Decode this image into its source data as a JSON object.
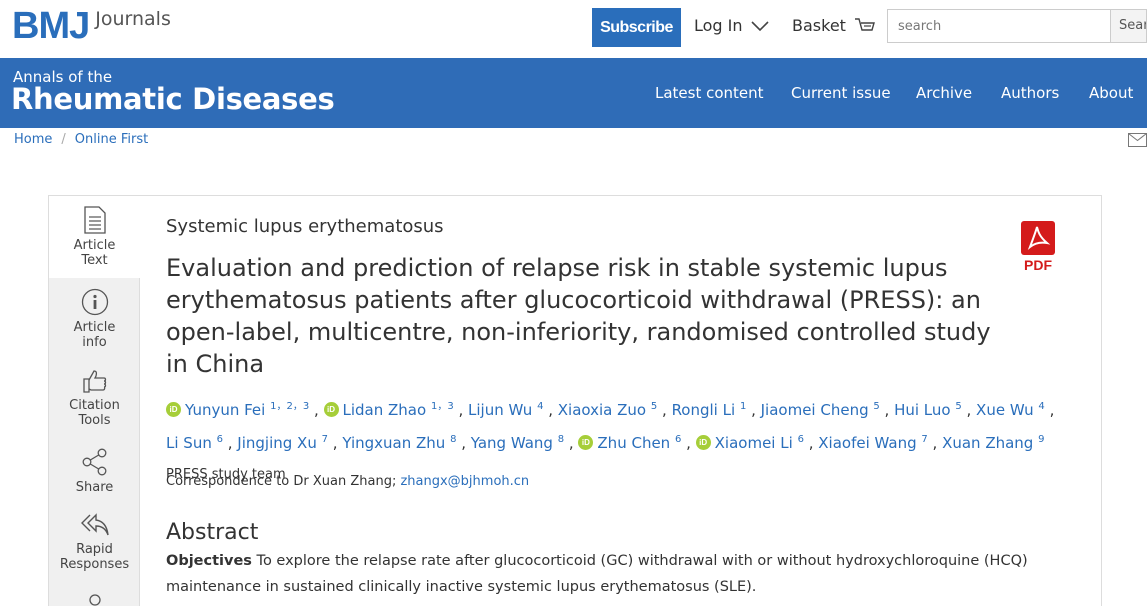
{
  "header": {
    "logo_mark": "BMJ",
    "logo_text": "Journals",
    "subscribe_label": "Subscribe",
    "login_label": "Log In",
    "basket_label": "Basket",
    "search_placeholder": "search",
    "search_button": "Search"
  },
  "journal": {
    "line1": "Annals of the",
    "line2": "Rheumatic Diseases",
    "nav": [
      "Latest content",
      "Current issue",
      "Archive",
      "Authors",
      "About"
    ]
  },
  "breadcrumb": [
    "Home",
    "Online First"
  ],
  "sidebar": {
    "items": [
      {
        "line1": "Article",
        "line2": "Text"
      },
      {
        "line1": "Article",
        "line2": "info"
      },
      {
        "line1": "Citation",
        "line2": "Tools"
      },
      {
        "line1": "Share",
        "line2": ""
      },
      {
        "line1": "Rapid",
        "line2": "Responses"
      }
    ]
  },
  "article": {
    "section": "Systemic lupus erythematosus",
    "title": "Evaluation and prediction of relapse risk in stable systemic lupus erythematosus patients after glucocorticoid withdrawal (PRESS): an open-label, multicentre, non-inferiority, randomised controlled study in China",
    "pdf_label": "PDF",
    "authors": [
      {
        "name": "Yunyun Fei",
        "sup": "1，2，3",
        "orcid": true
      },
      {
        "name": "Lidan Zhao",
        "sup": "1，3",
        "orcid": true
      },
      {
        "name": "Lijun Wu",
        "sup": "4",
        "orcid": false
      },
      {
        "name": "Xiaoxia Zuo",
        "sup": "5",
        "orcid": false
      },
      {
        "name": "Rongli Li",
        "sup": "1",
        "orcid": false
      },
      {
        "name": "Jiaomei Cheng",
        "sup": "5",
        "orcid": false
      },
      {
        "name": "Hui Luo",
        "sup": "5",
        "orcid": false
      },
      {
        "name": "Xue Wu",
        "sup": "4",
        "orcid": false
      },
      {
        "name": "Li Sun",
        "sup": "6",
        "orcid": false
      },
      {
        "name": "Jingjing Xu",
        "sup": "7",
        "orcid": false
      },
      {
        "name": "Yingxuan Zhu",
        "sup": "8",
        "orcid": false
      },
      {
        "name": "Yang Wang",
        "sup": "8",
        "orcid": true
      },
      {
        "name": "Zhu Chen",
        "sup": "6",
        "orcid": true
      },
      {
        "name": "Xiaomei Li",
        "sup": "6",
        "orcid": false
      },
      {
        "name": "Xiaofei Wang",
        "sup": "7",
        "orcid": false
      },
      {
        "name": "Xuan Zhang",
        "sup": "9",
        "orcid": false
      }
    ],
    "group_author": "PRESS study team",
    "orcid_text": "iD",
    "correspondence_prefix": "Correspondence to Dr Xuan Zhang;",
    "correspondence_email": "zhangx@bjhmoh.cn",
    "abstract_heading": "Abstract",
    "objectives_label": "Objectives",
    "objectives_text": "To explore the relapse rate after glucocorticoid (GC) withdrawal with or without hydroxychloroquine (HCQ) maintenance in sustained clinically inactive systemic lupus erythematosus (SLE)."
  },
  "colors": {
    "brand_blue": "#2f6cb7",
    "link_blue": "#2a6ebb",
    "pdf_red": "#d41b1b",
    "orcid_green": "#a6ce39"
  }
}
